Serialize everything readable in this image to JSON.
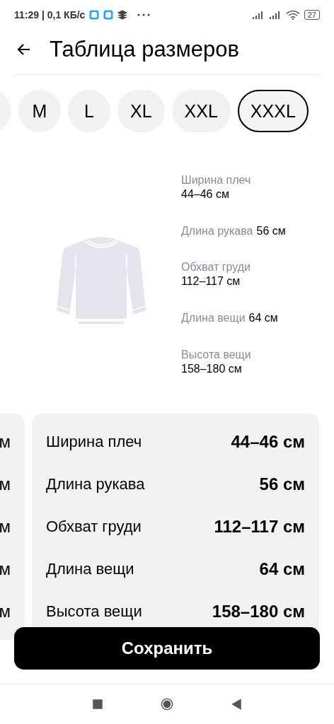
{
  "status_bar": {
    "time": "11:29 | 0,1 КБ/с",
    "battery": "27"
  },
  "header": {
    "title": "Таблица размеров"
  },
  "sizes": [
    {
      "selected": false
    },
    {
      "label": "M",
      "selected": false
    },
    {
      "label": "L",
      "selected": false
    },
    {
      "label": "XL",
      "selected": false
    },
    {
      "label": "XXL",
      "selected": false
    },
    {
      "label": "XXXL",
      "selected": true
    }
  ],
  "measurements": [
    {
      "kind": "stacked",
      "name": "Ширина плеч",
      "value": "44–46 см"
    },
    {
      "kind": "inline",
      "name": "Длина рукава",
      "value": "56 см"
    },
    {
      "kind": "stacked",
      "name": "Обхват груди",
      "value": "112–117 см"
    },
    {
      "kind": "inline",
      "name": "Длина вещи",
      "value": "64 см"
    },
    {
      "kind": "stacked",
      "name": "Высота вещи",
      "value": "158–180 см"
    }
  ],
  "previous_card": [
    "м",
    "м",
    "м",
    "м",
    "м"
  ],
  "table": [
    {
      "name": "Ширина плеч",
      "value": "44–46 см"
    },
    {
      "name": "Длина рукава",
      "value": "56 см"
    },
    {
      "name": "Обхват груди",
      "value": "112–117 см"
    },
    {
      "name": "Длина вещи",
      "value": "64 см"
    },
    {
      "name": "Высота вещи",
      "value": "158–180 см"
    }
  ],
  "save_button": "Сохранить"
}
